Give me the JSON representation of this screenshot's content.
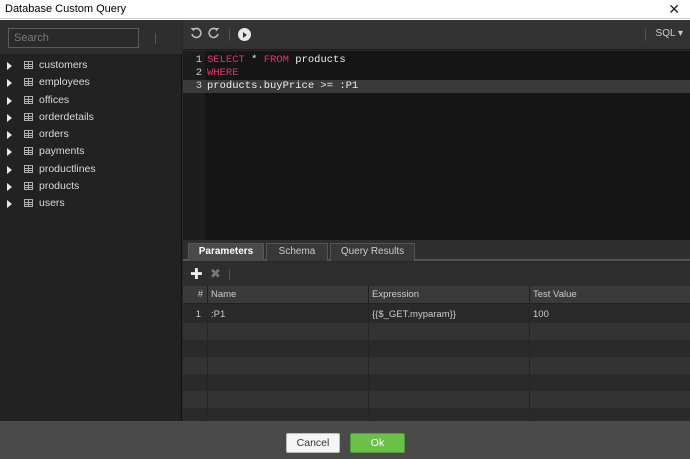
{
  "window": {
    "title": "Database Custom Query",
    "close_glyph": "✕"
  },
  "sidebar": {
    "search_placeholder": "Search",
    "tables": [
      {
        "label": "customers"
      },
      {
        "label": "employees"
      },
      {
        "label": "offices"
      },
      {
        "label": "orderdetails"
      },
      {
        "label": "orders"
      },
      {
        "label": "payments"
      },
      {
        "label": "productlines"
      },
      {
        "label": "products"
      },
      {
        "label": "users"
      }
    ]
  },
  "toolbar": {
    "undo_icon": "undo-icon",
    "redo_icon": "redo-icon",
    "run_icon": "run-icon",
    "language": "SQL",
    "language_caret": "▾"
  },
  "editor": {
    "lines": [
      {
        "num": "1",
        "segments": [
          {
            "text": "SELECT",
            "kw": true
          },
          {
            "text": " * ",
            "kw": false
          },
          {
            "text": "FROM",
            "kw": true
          },
          {
            "text": " products",
            "kw": false
          }
        ]
      },
      {
        "num": "2",
        "segments": [
          {
            "text": "WHERE",
            "kw": true
          }
        ]
      },
      {
        "num": "3",
        "segments": [
          {
            "text": "products.buyPrice >= :P1",
            "kw": false
          }
        ]
      }
    ],
    "active_line": 3
  },
  "tabs": [
    {
      "label": "Parameters",
      "active": true
    },
    {
      "label": "Schema",
      "active": false
    },
    {
      "label": "Query Results",
      "active": false
    }
  ],
  "params": {
    "add_glyph": "✚",
    "delete_glyph": "✖",
    "columns": [
      "#",
      "Name",
      "Expression",
      "Test Value"
    ],
    "rows": [
      {
        "index": "1",
        "name": ":P1",
        "expression": "{{$_GET.myparam}}",
        "test_value": "100"
      }
    ]
  },
  "footer": {
    "cancel_label": "Cancel",
    "ok_label": "Ok"
  },
  "colors": {
    "keyword": "#e8326a",
    "ok": "#6cc04a",
    "background": "#2a2a2a"
  }
}
